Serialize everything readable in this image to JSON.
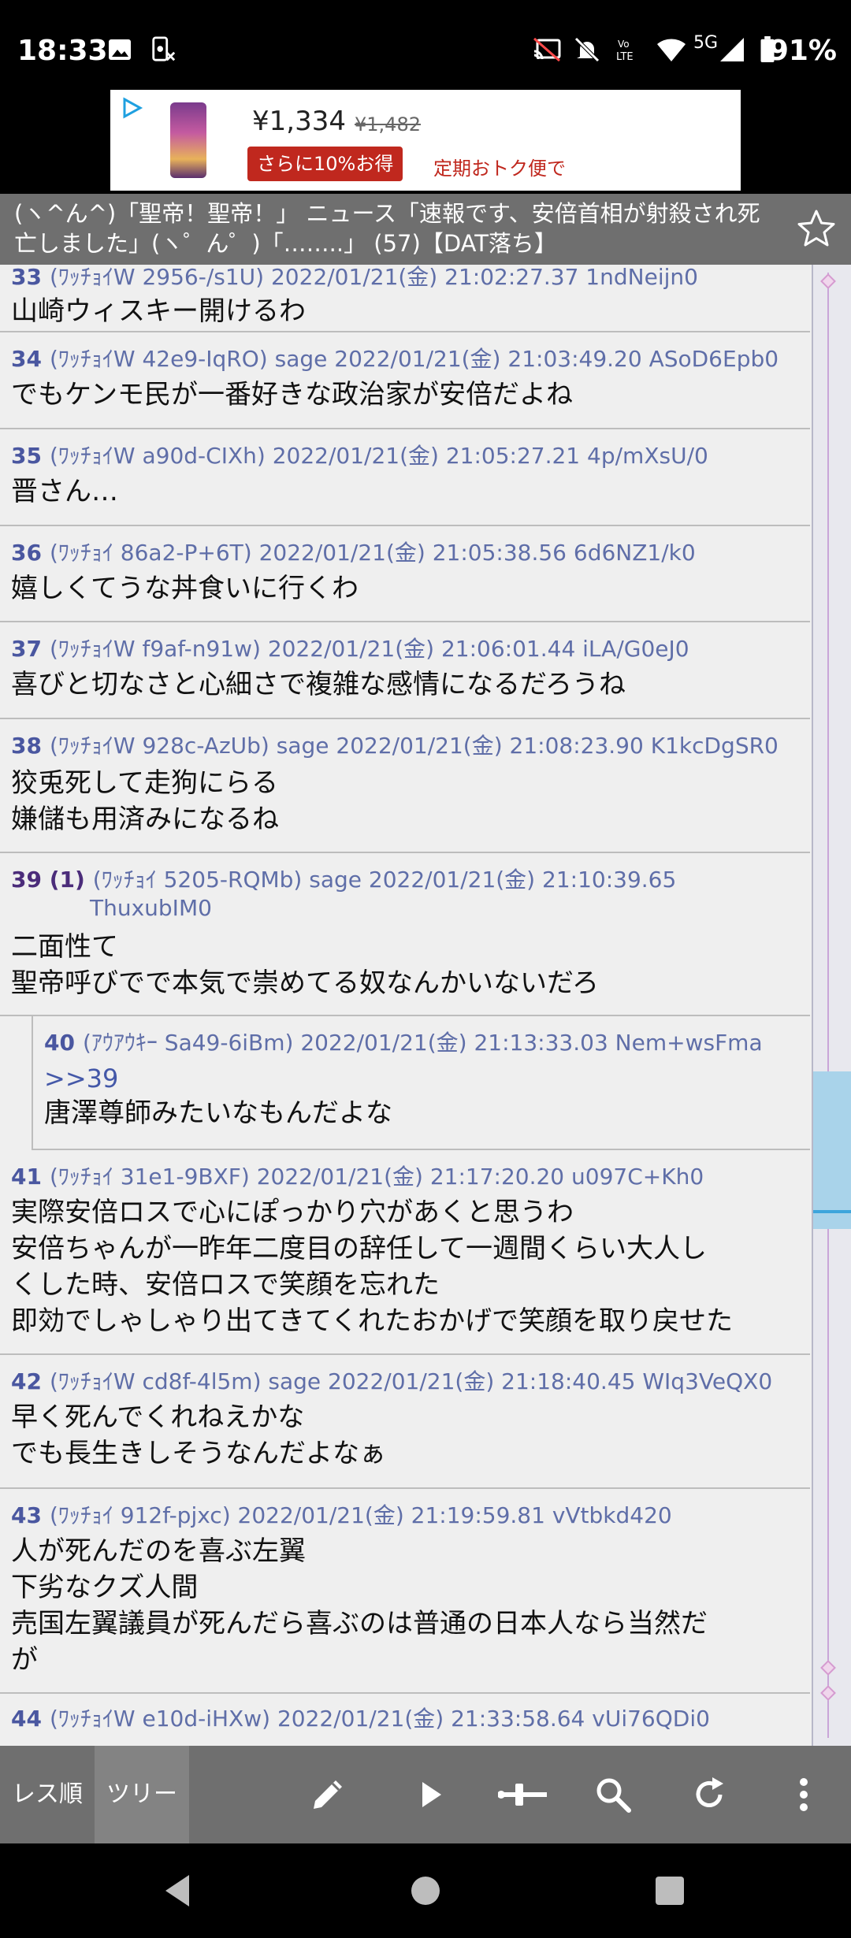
{
  "status": {
    "time": "18:33",
    "network": "5G",
    "battery": "91%"
  },
  "ad": {
    "price": "¥1,334",
    "old_price": "¥1,482",
    "badge": "さらに10%お得",
    "link": "定期おトク便で"
  },
  "thread": {
    "title": "(ヽ^ん^)「聖帝！聖帝！」 ニュース「速報です、安倍首相が射殺され死亡しました」(ヽ゜ん゜)「……..」 (57)【DAT落ち】"
  },
  "posts": [
    {
      "num": "33",
      "header": "(ﾜｯﾁｮｲW 2956-/s1U)  2022/01/21(金) 21:02:27.37 1ndNeijn0",
      "body": "山崎ウィスキー開けるわ"
    },
    {
      "num": "34",
      "header": "(ﾜｯﾁｮｲW 42e9-IqRO) sage 2022/01/21(金) 21:03:49.20 ASoD6Epb0",
      "body": "でもケンモ民が一番好きな政治家が安倍だよね"
    },
    {
      "num": "35",
      "header": "(ﾜｯﾁｮｲW a90d-CIXh)  2022/01/21(金) 21:05:27.21 4p/mXsU/0",
      "body": "晋さん…"
    },
    {
      "num": "36",
      "header": "(ﾜｯﾁｮｲ 86a2-P+6T)  2022/01/21(金) 21:05:38.56 6d6NZ1/k0",
      "body": "嬉しくてうな丼食いに行くわ"
    },
    {
      "num": "37",
      "header": "(ﾜｯﾁｮｲW f9af-n91w)  2022/01/21(金) 21:06:01.44 iLA/G0eJ0",
      "body": "喜びと切なさと心細さで複雑な感情になるだろうね"
    },
    {
      "num": "38",
      "header": "(ﾜｯﾁｮｲW 928c-AzUb) sage 2022/01/21(金) 21:08:23.90 K1kcDgSR0",
      "body": "狡兎死して走狗にらる\n嫌儲も用済みになるね"
    },
    {
      "num": "39 (1)",
      "header": "(ﾜｯﾁｮｲ 5205-RQMb) sage 2022/01/21(金) 21:10:39.65 ThuxubIM0",
      "body": "二面性て\n聖帝呼びでで本気で崇めてる奴なんかいないだろ"
    },
    {
      "num": "40",
      "header": "(ｱｳｱｳｷｰ Sa49-6iBm)  2022/01/21(金) 21:13:33.03 Nem+wsFma",
      "anchor": ">>39",
      "body": "唐澤尊師みたいなもんだよな"
    },
    {
      "num": "41",
      "header": "(ﾜｯﾁｮｲ 31e1-9BXF)  2022/01/21(金) 21:17:20.20 u097C+Kh0",
      "body": "実際安倍ロスで心にぽっかり穴があくと思うわ\n安倍ちゃんが一昨年二度目の辞任して一週間くらい大人し\nくした時、安倍ロスで笑顔を忘れた\n即効でしゃしゃり出てきてくれたおかげで笑顔を取り戻せた"
    },
    {
      "num": "42",
      "header": "(ﾜｯﾁｮｲW cd8f-4l5m) sage 2022/01/21(金) 21:18:40.45 WIq3VeQX0",
      "body": "早く死んでくれねえかな\nでも長生きしそうなんだよなぁ"
    },
    {
      "num": "43",
      "header": "(ﾜｯﾁｮｲ 912f-pjxc)  2022/01/21(金) 21:19:59.81 vVtbkd420",
      "body": "人が死んだのを喜ぶ左翼\n下劣なクズ人間\n売国左翼議員が死んだら喜ぶのは普通の日本人なら当然だ\nが"
    },
    {
      "num": "44",
      "header": "(ﾜｯﾁｮｲW e10d-iHXw)  2022/01/21(金) 21:33:58.64 vUi76QDi0",
      "body": ""
    }
  ],
  "toolbar": {
    "tab_order": "レス順",
    "tab_tree": "ツリー",
    "icons": [
      "pencil-icon",
      "play-icon",
      "slider-icon",
      "search-icon",
      "refresh-icon",
      "more-vert-icon"
    ]
  },
  "colors": {
    "title_bar": "#6f6f6f",
    "list_bg": "#efefef",
    "header_text": "#5c6aa4",
    "ad_badge": "#c0281e",
    "scroll_thumb": "#a9d3ea"
  }
}
